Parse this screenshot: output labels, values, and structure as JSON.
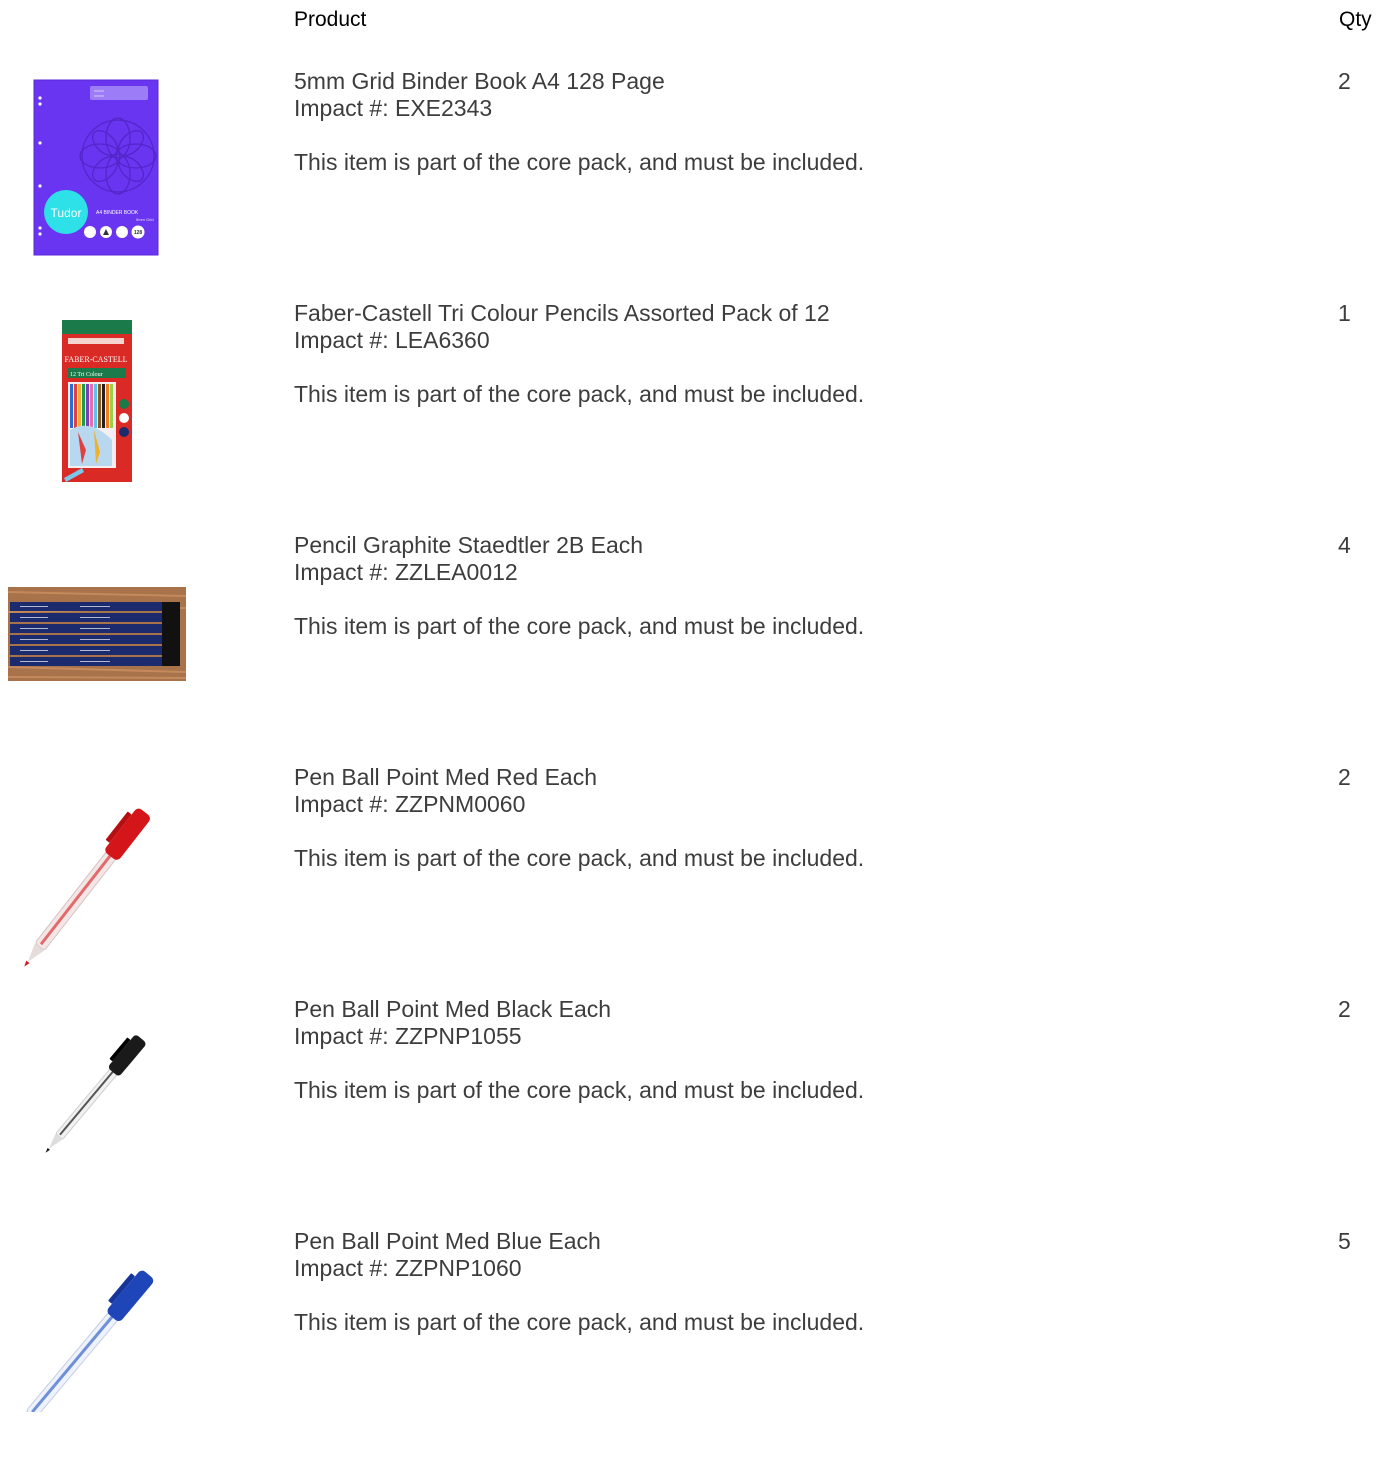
{
  "header": {
    "product_label": "Product",
    "qty_label": "Qty"
  },
  "items": [
    {
      "name": "5mm Grid Binder Book A4 128 Page",
      "impact": "Impact #: EXE2343",
      "note": "This item is part of the core pack, and must be included.",
      "qty": "2",
      "image": {
        "icon": "binder-book-image",
        "brand": "Tudor",
        "cover_text": "A4 BINDER BOOK",
        "sub_text": "5mm Grid",
        "page_badge": "128"
      }
    },
    {
      "name": "Faber-Castell Tri Colour Pencils Assorted Pack of 12",
      "impact": "Impact #: LEA6360",
      "note": "This item is part of the core pack, and must be included.",
      "qty": "1",
      "image": {
        "icon": "colour-pencils-box-image",
        "brand": "FABER-CASTELL",
        "cover_text": "12 Tri Colour"
      }
    },
    {
      "name": "Pencil Graphite Staedtler 2B Each",
      "impact": "Impact #: ZZLEA0012",
      "note": "This item is part of the core pack, and must be included.",
      "qty": "4",
      "image": {
        "icon": "graphite-pencils-image"
      }
    },
    {
      "name": "Pen Ball Point Med Red Each",
      "impact": "Impact #: ZZPNM0060",
      "note": "This item is part of the core pack, and must be included.",
      "qty": "2",
      "image": {
        "icon": "red-ballpoint-pen-image"
      }
    },
    {
      "name": "Pen Ball Point Med Black Each",
      "impact": "Impact #: ZZPNP1055",
      "note": "This item is part of the core pack, and must be included.",
      "qty": "2",
      "image": {
        "icon": "black-ballpoint-pen-image"
      }
    },
    {
      "name": "Pen Ball Point Med Blue Each",
      "impact": "Impact #: ZZPNP1060",
      "note": "This item is part of the core pack, and must be included.",
      "qty": "5",
      "image": {
        "icon": "blue-ballpoint-pen-image"
      }
    }
  ],
  "colors": {
    "text": "#3d3d3d",
    "header_text": "#000000",
    "binder_cover": "#6a35f0",
    "tudor_circle": "#2ee0e8",
    "faber_box_red": "#d92a26",
    "faber_box_green": "#1a7a4a",
    "pencil_navy": "#1c2a6e",
    "wood": "#a8724a",
    "pen_red": "#d4161a",
    "pen_black": "#1a1a1a",
    "pen_blue": "#1f46b8"
  }
}
